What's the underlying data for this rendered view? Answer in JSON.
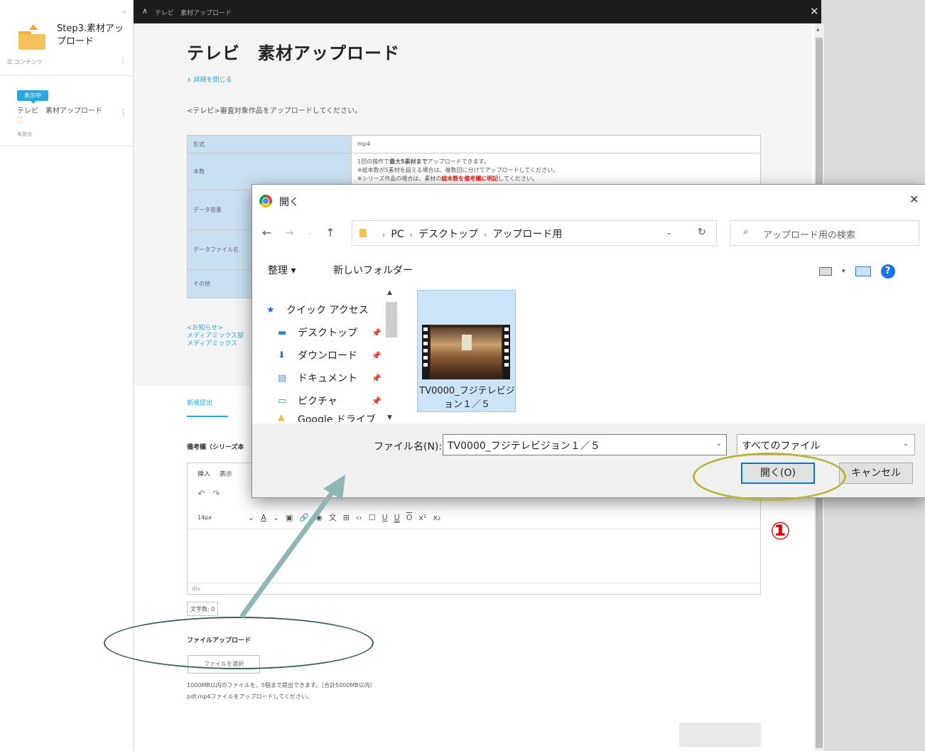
{
  "sidebar": {
    "course_title": "Step3.素材アップロード",
    "contents_link": "☰ コンテンツ",
    "badge": "表示中",
    "item_title": "テレビ　素材アップロード",
    "item_status": "未提出"
  },
  "topbar": {
    "breadcrumb": "テレビ　素材アップロード"
  },
  "page": {
    "title": "テレビ　素材アップロード",
    "detail_toggle": "∧ 詳細を閉じる",
    "instruction": "<テレビ>審査対象作品をアップロードしてください。",
    "spec_rows": [
      {
        "label": "形式",
        "value": "mp4"
      },
      {
        "label": "本数",
        "value_line1_pre": "1回の操作で",
        "value_line1_bold": "最大5素材まで",
        "value_line1_post": "アップロードできます。",
        "value_line2": "※総本数が5素材を超える場合は、複数回に分けてアップロードしてください。",
        "value_line3_pre": "※シリーズ作品の場合は、素材の",
        "value_line3_red": "総本数を備考欄に明記",
        "value_line3_post": "してください。"
      },
      {
        "label": "データ容量",
        "value": ""
      },
      {
        "label": "データファイル名",
        "value": ""
      },
      {
        "label": "その他",
        "value": ""
      }
    ],
    "notice": [
      "<お知らせ>",
      "メディアミックス部",
      "メディアミックス"
    ],
    "tab_new": "新規提出",
    "remarks_label": "備考欄（シリーズ本",
    "editor": {
      "menu": [
        "挿入",
        "表示"
      ],
      "font_size": "14px",
      "status_path": "div"
    },
    "char_count": "文字数: 0",
    "upload_label": "ファイルアップロード",
    "file_button": "ファイルを選択",
    "upload_note_1": "1000MB以内のファイルを、5個まで提出できます。（合計5000MB以内）",
    "upload_note_2": "pdf,mp4ファイルをアップロードしてください。"
  },
  "dialog": {
    "title": "開く",
    "path": [
      "PC",
      "デスクトップ",
      "アップロード用"
    ],
    "search_placeholder": "アップロード用の検索",
    "organize": "整理 ▾",
    "new_folder": "新しいフォルダー",
    "nav_items": [
      {
        "label": "クイック アクセス",
        "icon": "star-icon"
      },
      {
        "label": "デスクトップ",
        "icon": "desktop-icon"
      },
      {
        "label": "ダウンロード",
        "icon": "download-icon"
      },
      {
        "label": "ドキュメント",
        "icon": "document-icon"
      },
      {
        "label": "ピクチャ",
        "icon": "picture-icon"
      },
      {
        "label": "Google ドライブ",
        "icon": "drive-icon"
      }
    ],
    "file_tile_name": "TV0000_フジテレビジョン１／５",
    "filename_label": "ファイル名(N):",
    "filename_value": "TV0000_フジテレビジョン１／５",
    "file_type": "すべてのファイル",
    "open_button": "開く(O)",
    "cancel_button": "キャンセル"
  },
  "annotation": {
    "step_number": "①",
    "highlight_color": "#b8b53a",
    "arrow_color": "#8fb5b5",
    "ellipse_color": "#3d6060"
  }
}
